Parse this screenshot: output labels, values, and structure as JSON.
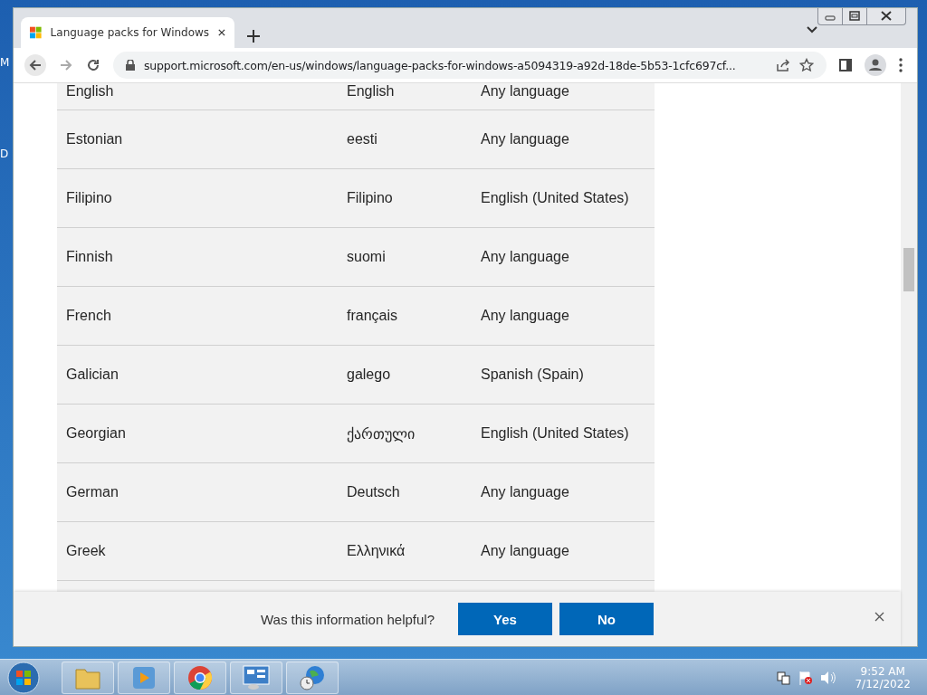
{
  "desktop_labels": [
    "M",
    "D"
  ],
  "tabs": [
    {
      "title": "Language packs for Windows",
      "selected": true
    }
  ],
  "address": "support.microsoft.com/en-us/windows/language-packs-for-windows-a5094319-a92d-18de-5b53-1cfc697cf...",
  "table": {
    "rows": [
      {
        "language": "English",
        "native": "English",
        "base": "Any language"
      },
      {
        "language": "Estonian",
        "native": "eesti",
        "base": "Any language"
      },
      {
        "language": "Filipino",
        "native": "Filipino",
        "base": "English (United States)"
      },
      {
        "language": "Finnish",
        "native": "suomi",
        "base": "Any language"
      },
      {
        "language": "French",
        "native": "français",
        "base": "Any language"
      },
      {
        "language": "Galician",
        "native": "galego",
        "base": "Spanish (Spain)"
      },
      {
        "language": "Georgian",
        "native": "ქართული",
        "base": "English (United States)"
      },
      {
        "language": "German",
        "native": "Deutsch",
        "base": "Any language"
      },
      {
        "language": "Greek",
        "native": "Ελληνικά",
        "base": "Any language"
      }
    ]
  },
  "feedback": {
    "question": "Was this information helpful?",
    "buttons": [
      "Yes",
      "No"
    ]
  },
  "taskbar": {
    "apps": [
      {
        "kind": "folder"
      },
      {
        "kind": "media"
      },
      {
        "kind": "chrome"
      },
      {
        "kind": "panel"
      },
      {
        "kind": "globe"
      }
    ],
    "time": "9:52 AM",
    "date": "7/12/2022"
  }
}
